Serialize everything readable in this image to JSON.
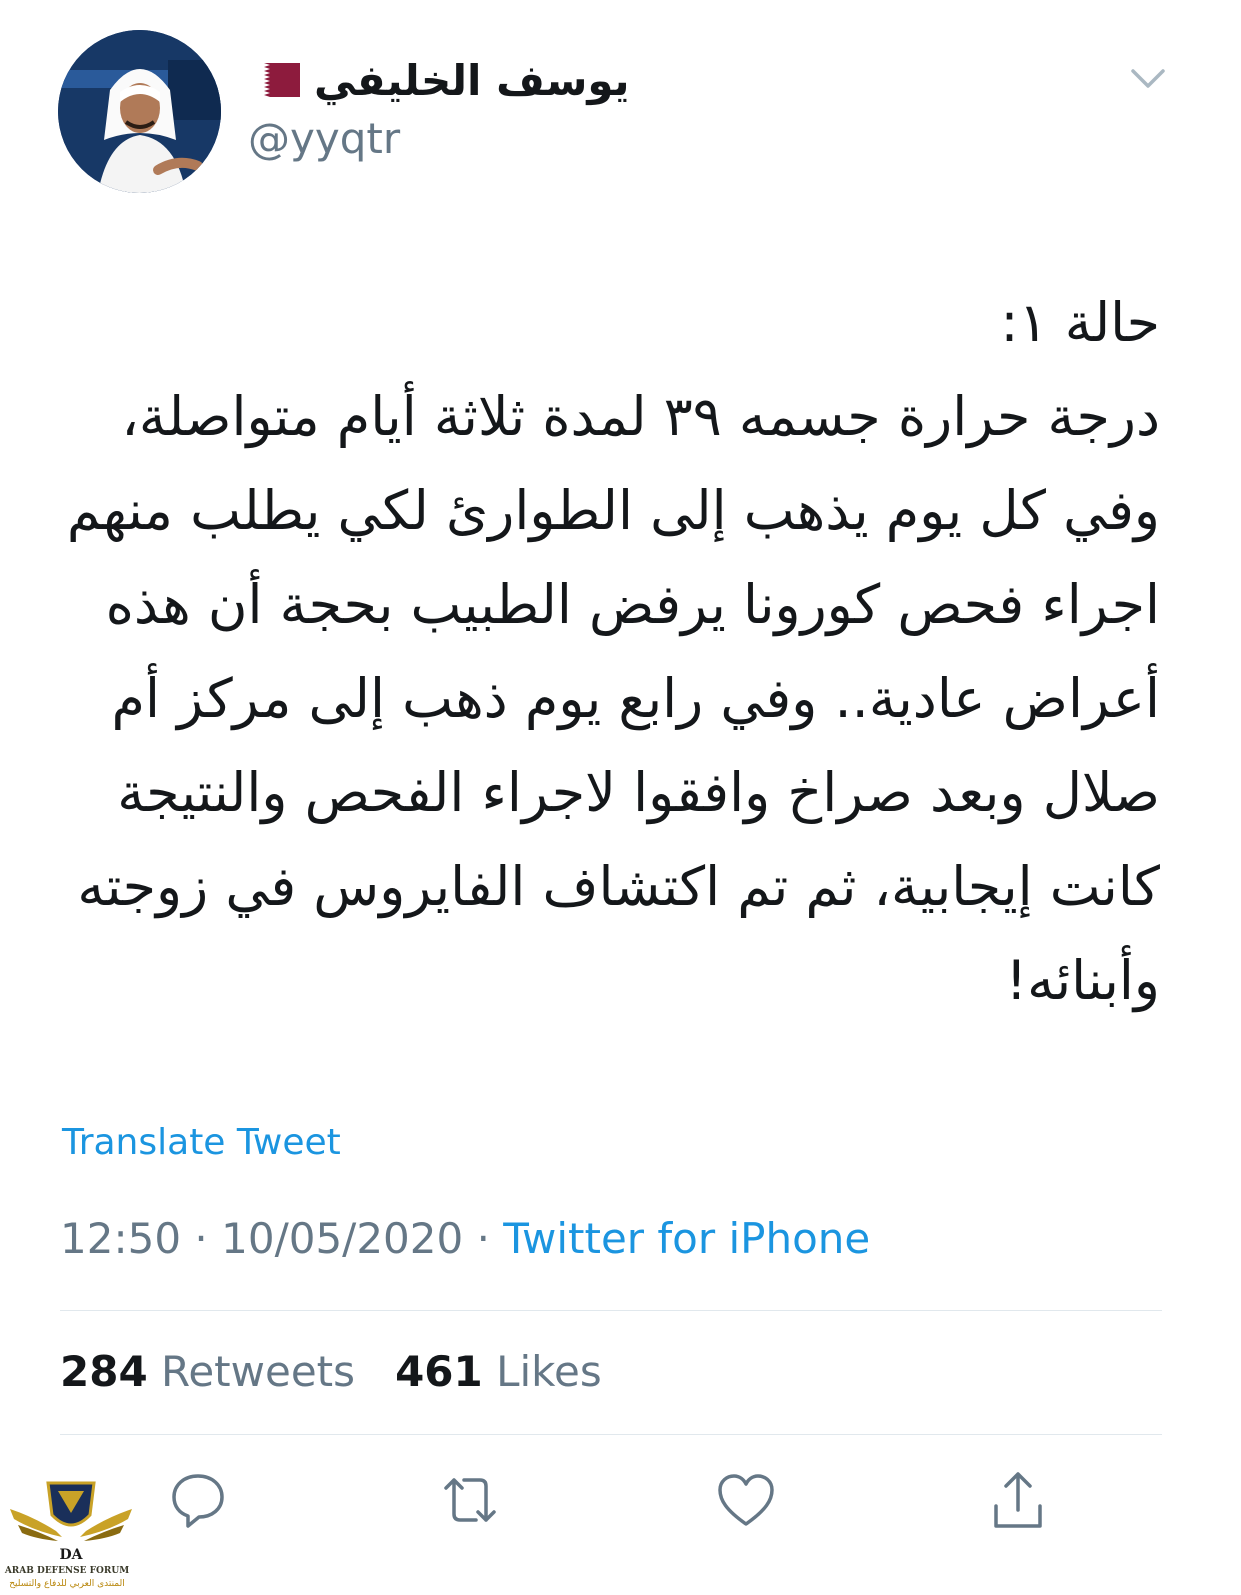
{
  "tweet": {
    "display_name": "يوسف الخليفي",
    "handle": "@yyqtr",
    "text": "حالة ١:\nدرجة حرارة جسمه ٣٩ لمدة ثلاثة أيام متواصلة، وفي كل يوم يذهب إلى الطوارئ لكي يطلب منهم اجراء فحص كورونا يرفض الطبيب بحجة أن هذه أعراض عادية.. وفي رابع يوم ذهب إلى مركز أم صلال وبعد صراخ وافقوا لاجراء الفحص والنتيجة كانت إيجابية، ثم تم اكتشاف الفايروس في زوجته وأبنائه!",
    "translate_label": "Translate Tweet",
    "time": "12:50",
    "date": "10/05/2020",
    "separator": "·",
    "source": "Twitter for iPhone",
    "retweets_count": "284",
    "retweets_label": "Retweets",
    "likes_count": "461",
    "likes_label": "Likes"
  },
  "icons": {
    "flag": "qatar-flag-icon",
    "menu": "chevron-down-icon",
    "reply": "reply-icon",
    "retweet": "retweet-icon",
    "like": "heart-icon",
    "share": "share-icon"
  },
  "watermark": {
    "logo_letters": "DA",
    "line1": "ARAB DEFENSE FORUM",
    "line2": "المنتدى العربي للدفاع والتسليح"
  },
  "colors": {
    "text": "#14171a",
    "secondary": "#657786",
    "link": "#1b95e0",
    "divider": "#e1e8ed"
  }
}
